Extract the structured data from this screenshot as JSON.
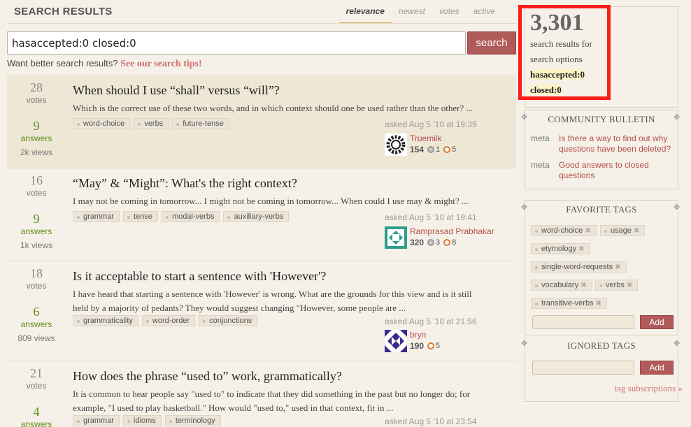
{
  "header": {
    "title": "SEARCH RESULTS",
    "tabs": [
      {
        "label": "relevance",
        "active": true
      },
      {
        "label": "newest",
        "active": false
      },
      {
        "label": "votes",
        "active": false
      },
      {
        "label": "active",
        "active": false
      }
    ]
  },
  "search": {
    "value": "hasaccepted:0 closed:0",
    "button_label": "search",
    "tips_prefix": "Want better search results?",
    "tips_link": "See our search tips!"
  },
  "questions": [
    {
      "votes": "28",
      "votes_label": "votes",
      "answers": "9",
      "answers_label": "answers",
      "views": "2k views",
      "title": "When should I use “shall” versus “will”?",
      "excerpt": "Which is the correct use of these two words, and in which context should one be used rather than the other? ...",
      "tags": [
        "word-choice",
        "verbs",
        "future-tense"
      ],
      "asked": "asked Aug 5 '10 at 19:39",
      "user": {
        "name": "Truemilk",
        "rep": "154",
        "silver": "1",
        "bronze": "5"
      }
    },
    {
      "votes": "16",
      "votes_label": "votes",
      "answers": "9",
      "answers_label": "answers",
      "views": "1k views",
      "title": "“May” & “Might”: What's the right context?",
      "excerpt": "I may not be coming in tomorrow... I might not be coming in tomorrow... When could I use may & might? ...",
      "tags": [
        "grammar",
        "tense",
        "modal-verbs",
        "auxiliary-verbs"
      ],
      "asked": "asked Aug 5 '10 at 19:41",
      "user": {
        "name": "Ramprasad Prabhakar",
        "rep": "320",
        "silver": "3",
        "bronze": "8"
      }
    },
    {
      "votes": "18",
      "votes_label": "votes",
      "answers": "6",
      "answers_label": "answers",
      "views": "809 views",
      "title": "Is it acceptable to start a sentence with 'However'?",
      "excerpt_line1": "I have heard that starting a sentence with 'However' is wrong. What are the grounds for this view and is it still",
      "excerpt_line2": "held by a majority of pedants? They would suggest changing \"However, some people are ...",
      "tags": [
        "grammaticality",
        "word-order",
        "conjunctions"
      ],
      "asked": "asked Aug 5 '10 at 21:56",
      "user": {
        "name": "bryn",
        "rep": "190",
        "bronze": "5"
      }
    },
    {
      "votes": "21",
      "votes_label": "votes",
      "answers": "4",
      "answers_label": "answers",
      "title": "How does the phrase “used to” work, grammatically?",
      "excerpt_line1": "It is common to hear people say \"used to\" to indicate that they did something in the past but no longer do; for",
      "excerpt_line2": "example, \"I used to play basketball.\" How would \"used to,\" used in that context, fit in ...",
      "tags": [
        "grammar",
        "idioms",
        "terminology"
      ],
      "asked": "asked Aug 5 '10 at 23:54"
    }
  ],
  "sidebar": {
    "result_count": "3,301",
    "result_text_1": "search results for",
    "result_text_2": "search options",
    "option_1": "hasaccepted:0",
    "option_2": "closed:0",
    "bulletin_title": "COMMUNITY BULLETIN",
    "bulletin": [
      {
        "meta": "meta",
        "text": "Is there a way to find out why questions have been deleted?"
      },
      {
        "meta": "meta",
        "text": "Good answers to closed questions"
      }
    ],
    "favorite_title": "FAVORITE TAGS",
    "favorite_tags": [
      "word-choice",
      "usage",
      "etymology",
      "single-word-requests",
      "vocabulary",
      "verbs",
      "transitive-verbs"
    ],
    "add_label": "Add",
    "ignored_title": "IGNORED TAGS",
    "subscriptions_link": "tag subscriptions »"
  }
}
